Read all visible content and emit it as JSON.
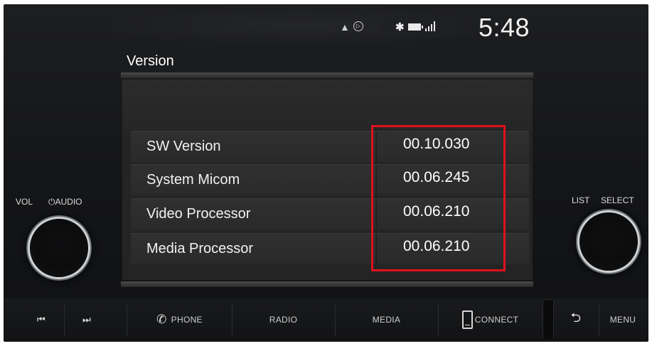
{
  "status_bar": {
    "nav_icon": "navigation-arrow-icon",
    "circle_icon": "media-source-icon",
    "bluetooth_icon": "bluetooth-icon",
    "battery_icon": "battery-icon",
    "signal_icon": "signal-strength-icon",
    "time": "5:48"
  },
  "screen": {
    "title": "Version",
    "rows": [
      {
        "label": "SW Version",
        "value": "00.10.030"
      },
      {
        "label": "System Micom",
        "value": "00.06.245"
      },
      {
        "label": "Video Processor",
        "value": "00.06.210"
      },
      {
        "label": "Media Processor",
        "value": "00.06.210"
      }
    ],
    "highlight_color": "#e0111d"
  },
  "left_knob": {
    "vol_label": "VOL",
    "audio_label": "⏻AUDIO"
  },
  "right_knob": {
    "list_label": "LIST",
    "select_label": "SELECT"
  },
  "bottom_bar": {
    "prev_icon": "⏮",
    "next_icon": "⏭",
    "phone": "PHONE",
    "radio": "RADIO",
    "media": "MEDIA",
    "connect": "CONNECT",
    "back_icon": "⮌",
    "menu": "MENU"
  }
}
